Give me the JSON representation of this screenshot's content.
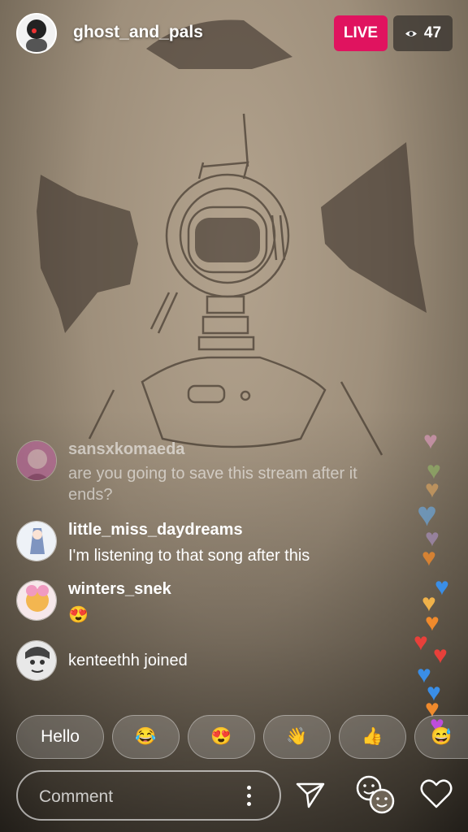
{
  "header": {
    "host_name": "ghost_and_pals",
    "live_label": "LIVE",
    "viewer_count": "47"
  },
  "comments": [
    {
      "user": "sansxkomaeda",
      "text": "are you going to save this stream after it ends?"
    },
    {
      "user": "little_miss_daydreams",
      "text": "I'm listening to that song after this"
    },
    {
      "user": "winters_snek",
      "text": "😍"
    },
    {
      "user": "kenteethh",
      "text": "kenteethh joined"
    }
  ],
  "quick_replies": [
    "Hello",
    "😂",
    "😍",
    "👋",
    "👍",
    "😅"
  ],
  "comment_bar": {
    "placeholder": "Comment"
  },
  "icons": {
    "viewers": "eye-icon",
    "more": "more-vertical-icon",
    "send": "paper-plane-icon",
    "faces": "face-filter-icon",
    "like": "heart-icon"
  },
  "colors": {
    "live": "#e0135f",
    "heart_pink": "#e8a0c8",
    "heart_orange": "#f08a2c",
    "heart_blue": "#3a8ee6",
    "heart_red": "#e8403a",
    "heart_purple": "#b026d4"
  }
}
